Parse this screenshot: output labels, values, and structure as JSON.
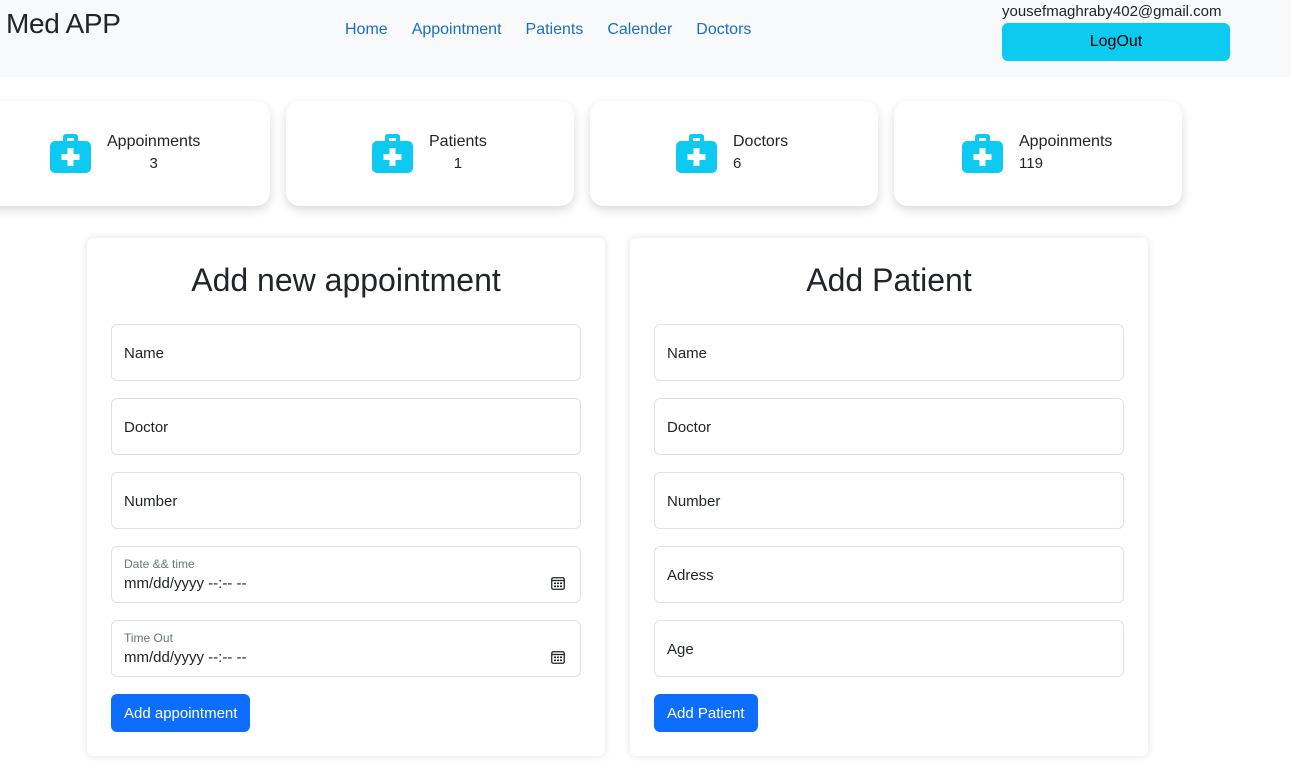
{
  "navbar": {
    "brand": "Med APP",
    "links": [
      "Home",
      "Appointment",
      "Patients",
      "Calender",
      "Doctors"
    ],
    "user_email": "yousefmaghraby402@gmail.com",
    "logout_label": "LogOut"
  },
  "colors": {
    "accent": "#0dcaf0",
    "primary": "#0d6efd",
    "link": "#1b6ec2",
    "navbar_bg": "#f8f9fa"
  },
  "stats": [
    {
      "label": "Appoinments",
      "value": "3",
      "icon": "medical-kit-icon"
    },
    {
      "label": "Patients",
      "value": "1",
      "icon": "medical-kit-icon"
    },
    {
      "label": "Doctors",
      "value": "6",
      "icon": "medical-kit-icon"
    },
    {
      "label": "Appoinments",
      "value": "119",
      "icon": "medical-kit-icon"
    }
  ],
  "appointment_form": {
    "title": "Add new appointment",
    "name_placeholder": "Name",
    "doctor_placeholder": "Doctor",
    "number_placeholder": "Number",
    "datetime_label": "Date && time",
    "datetime_value": "mm/dd/yyyy --:-- --",
    "timeout_label": "Time Out",
    "timeout_value": "mm/dd/yyyy --:-- --",
    "submit_label": "Add appointment"
  },
  "patient_form": {
    "title": "Add Patient",
    "name_placeholder": "Name",
    "doctor_placeholder": "Doctor",
    "number_placeholder": "Number",
    "address_placeholder": "Adress",
    "age_placeholder": "Age",
    "submit_label": "Add Patient"
  }
}
